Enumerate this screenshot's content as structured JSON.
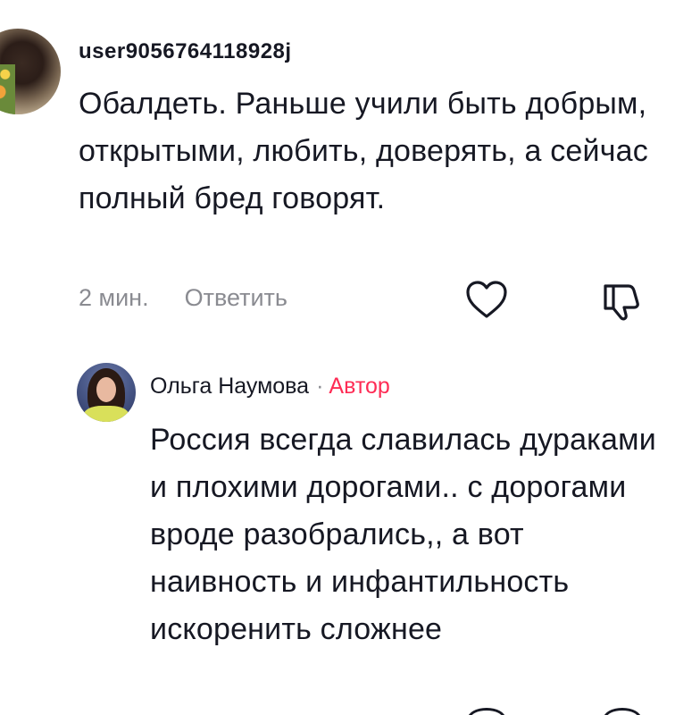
{
  "comments": [
    {
      "username": "user9056764118928j",
      "text": "Обалдеть. Раньше учили быть добрым, открытыми, любить, доверять, а сейчас полный бред говорят.",
      "time": "2 мин.",
      "reply_label": "Ответить",
      "icons": {
        "like": "heart-outline-icon",
        "dislike": "thumbs-down-outline-icon"
      }
    },
    {
      "username": "Ольга Наумова",
      "separator": "·",
      "badge": "Автор",
      "text": "Россия всегда славилась дураками и плохими дорогами.. с дорогами вроде разобрались,, а вот наивность и инфантильность искоренить сложнее"
    }
  ],
  "colors": {
    "text_primary": "#161823",
    "text_secondary": "#8a8b91",
    "author_badge": "#fe2c55",
    "background": "#ffffff"
  }
}
